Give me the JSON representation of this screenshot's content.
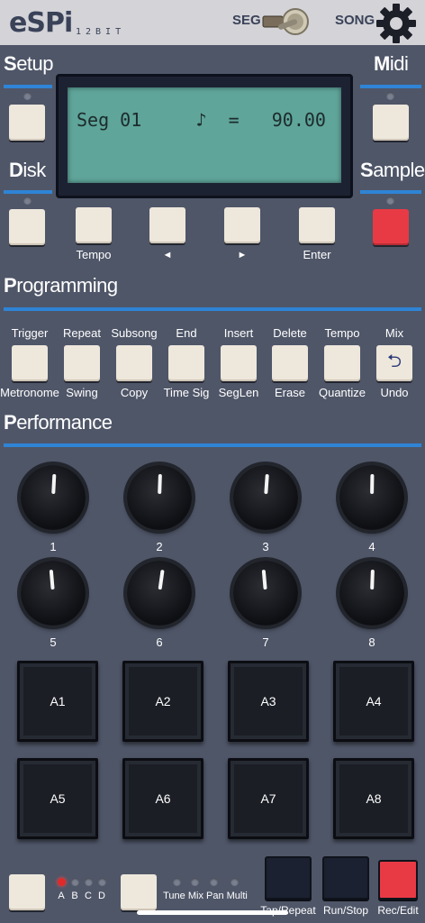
{
  "header": {
    "logo": "eSPi",
    "logo_sub": "12BIT",
    "seg_label": "SEG",
    "song_label": "SONG",
    "icons": [
      "toggle-switch-icon",
      "gear-icon"
    ]
  },
  "sections": {
    "setup": {
      "first": "S",
      "rest": "etup"
    },
    "midi": {
      "first": "M",
      "rest": "idi"
    },
    "disk": {
      "first": "D",
      "rest": "isk"
    },
    "sample": {
      "first": "S",
      "rest": "ample"
    },
    "programming": {
      "first": "P",
      "rest": "rogramming"
    },
    "performance": {
      "first": "P",
      "rest": "erformance"
    }
  },
  "lcd": {
    "text": "Seg 01     ♪  =   90.00"
  },
  "row_buttons": {
    "tempo": "Tempo",
    "left": "◄",
    "right": "►",
    "enter": "Enter"
  },
  "programming": {
    "top_labels": [
      "Trigger",
      "Repeat",
      "Subsong",
      "End",
      "Insert",
      "Delete",
      "Tempo",
      "Mix"
    ],
    "bottom_labels": [
      "Metronome",
      "Swing",
      "Copy",
      "Time Sig",
      "SegLen",
      "Erase",
      "Quantize",
      "Undo"
    ],
    "undo_icon": "undo-arrow-icon"
  },
  "knobs": [
    "1",
    "2",
    "3",
    "4",
    "5",
    "6",
    "7",
    "8"
  ],
  "pads": [
    "A1",
    "A2",
    "A3",
    "A4",
    "A5",
    "A6",
    "A7",
    "A8"
  ],
  "bottom": {
    "banks": [
      "A",
      "B",
      "C",
      "D"
    ],
    "active_bank": "A",
    "modes": "Tune Mix Pan Multi",
    "tap_repeat": "Tap/Repeat",
    "run_stop": "Run/Stop",
    "rec_edit": "Rec/Edit"
  },
  "colors": {
    "accent": "#2f84d6",
    "record_red": "#e83a45",
    "lcd": "#5fa59a",
    "panel": "#4f5668"
  }
}
